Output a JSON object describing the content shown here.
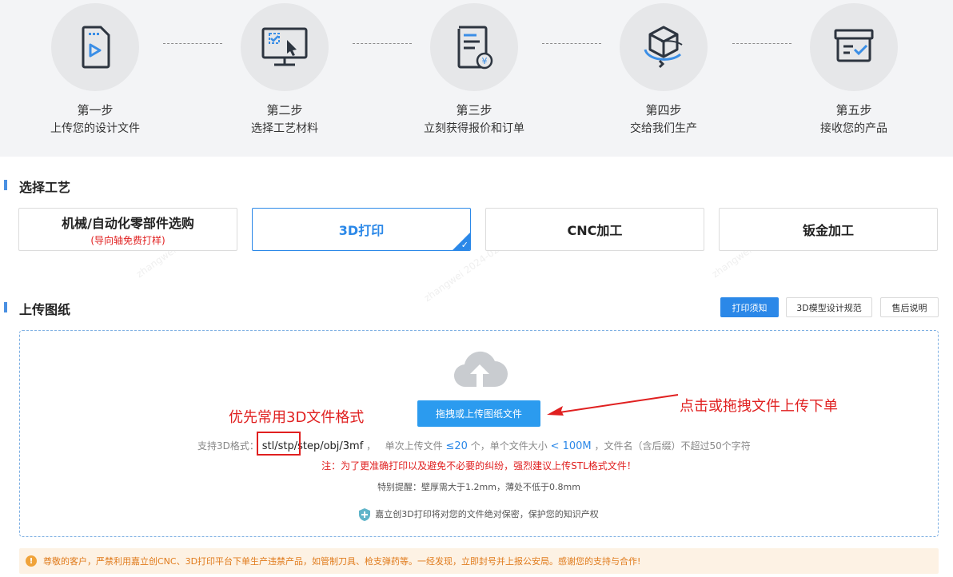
{
  "steps": [
    {
      "title": "第一步",
      "desc": "上传您的设计文件"
    },
    {
      "title": "第二步",
      "desc": "选择工艺材料"
    },
    {
      "title": "第三步",
      "desc": "立刻获得报价和订单"
    },
    {
      "title": "第四步",
      "desc": "交给我们生产"
    },
    {
      "title": "第五步",
      "desc": "接收您的产品"
    }
  ],
  "process": {
    "title": "选择工艺",
    "cards": [
      {
        "name": "机械/自动化零部件选购",
        "sub": "(导向轴免费打样)"
      },
      {
        "name": "3D打印",
        "active": true
      },
      {
        "name": "CNC加工"
      },
      {
        "name": "钣金加工"
      }
    ]
  },
  "upload": {
    "title": "上传图纸",
    "tabs": [
      "打印须知",
      "3D模型设计规范",
      "售后说明"
    ],
    "button_label": "拖拽或上传图纸文件",
    "format_label": "支持3D格式：",
    "formats": "stl/stp/step/obj/3mf",
    "format_sep": "，",
    "count_label": "单次上传文件",
    "count_value": "≤20",
    "count_unit": "个，单个文件大小",
    "size_value": "< 100M",
    "size_tail": "，文件名（含后缀）不超过50个字符",
    "note_red": "注：为了更准确打印以及避免不必要的纠纷，强烈建议上传STL格式文件！",
    "note_gray": "特别提醒：壁厚需大于1.2mm，薄处不低于0.8mm",
    "secure_text": "嘉立创3D打印将对您的文件绝对保密，保护您的知识产权"
  },
  "annotations": {
    "left": "优先常用3D文件格式",
    "right": "点击或拖拽文件上传下单"
  },
  "warning": {
    "icon": "!",
    "text": "尊敬的客户，严禁利用嘉立创CNC、3D打印平台下单生产违禁产品，如管制刀具、枪支弹药等。一经发现，立即封号并上报公安局。感谢您的支持与合作!"
  },
  "colors": {
    "accent": "#2b88e8",
    "annotation_red": "#e02020",
    "warning_bg": "#fdf2e4",
    "warning_text": "#e07b1c"
  }
}
